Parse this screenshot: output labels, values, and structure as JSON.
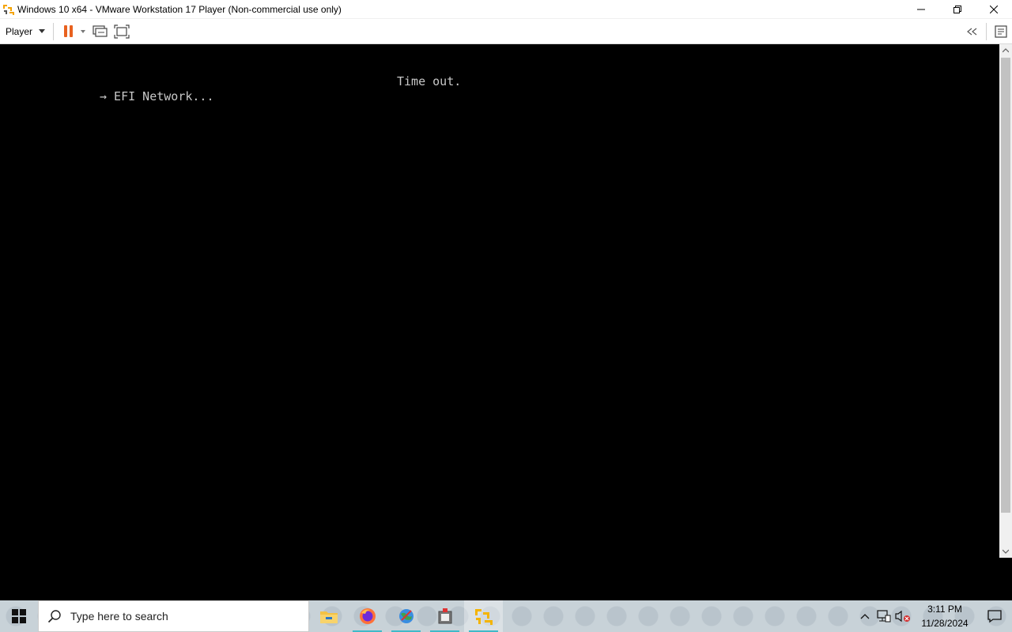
{
  "window": {
    "title": "Windows 10 x64 - VMware Workstation 17 Player (Non-commercial use only)",
    "icon": "vmware-player-icon"
  },
  "toolbar": {
    "player_menu": "Player",
    "buttons": [
      "pause-icon",
      "send-ctrl-alt-del-icon",
      "fullscreen-icon",
      "unity-icon",
      "message-log-icon"
    ],
    "pause_color": "#e8611f"
  },
  "vm_console": {
    "line_timeout": "Time out.",
    "line_efi": "→ EFI Network..."
  },
  "taskbar": {
    "search_placeholder": "Type here to search",
    "apps": [
      "file-explorer-icon",
      "firefox-icon",
      "network-globe-icon",
      "archive-tool-icon",
      "vmware-player-icon"
    ],
    "accent": "#3fb9c8"
  },
  "tray": {
    "time": "3:11 PM",
    "date": "11/28/2024"
  }
}
